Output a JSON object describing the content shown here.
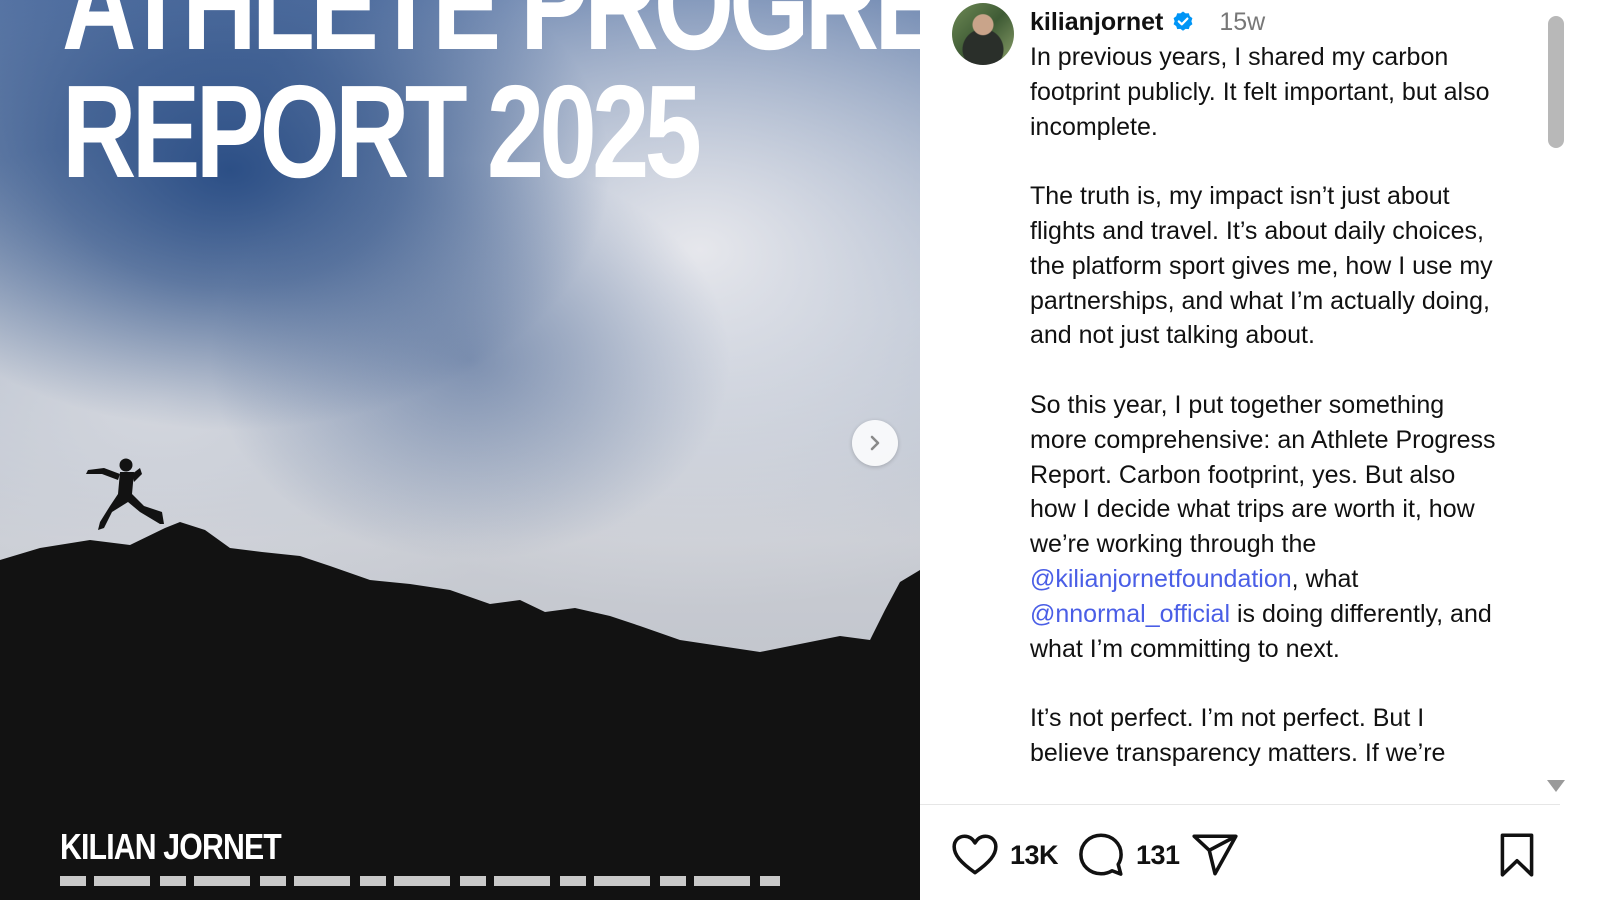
{
  "post_image": {
    "headline_line1": "ATHLETE PROGRESS",
    "headline_line2": "REPORT 2025",
    "author_tag": "KILIAN JORNET",
    "next_icon": "chevron-right-icon"
  },
  "post": {
    "username": "kilianjornet",
    "verified_icon": "verified-badge-icon",
    "time_ago": "15w",
    "caption": {
      "p1": "In previous years, I shared my carbon footprint publicly. It felt important, but also incomplete.",
      "p2": "The truth is, my impact isn’t just about flights and travel. It’s about daily choices, the platform sport gives me, how I use my partnerships, and what I’m actually doing, and not just talking about.",
      "p3_a": "So this year, I put together something more comprehensive: an Athlete Progress Report. Carbon footprint, yes. But also how I decide what trips are worth it, how we’re working through the ",
      "mention1": "@kilianjornetfoundation",
      "p3_b": ", what ",
      "mention2": "@nnormal_official",
      "p3_c": " is doing differently, and what I’m committing to next.",
      "p4": "It’s not perfect. I’m not perfect. But I believe transparency matters. If we’re"
    }
  },
  "actions": {
    "like_icon": "heart-icon",
    "like_count": "13K",
    "comment_icon": "comment-icon",
    "comment_count": "131",
    "share_icon": "send-icon",
    "save_icon": "bookmark-icon"
  },
  "colors": {
    "mention": "#4a5ee6",
    "verified": "#0095f6"
  }
}
